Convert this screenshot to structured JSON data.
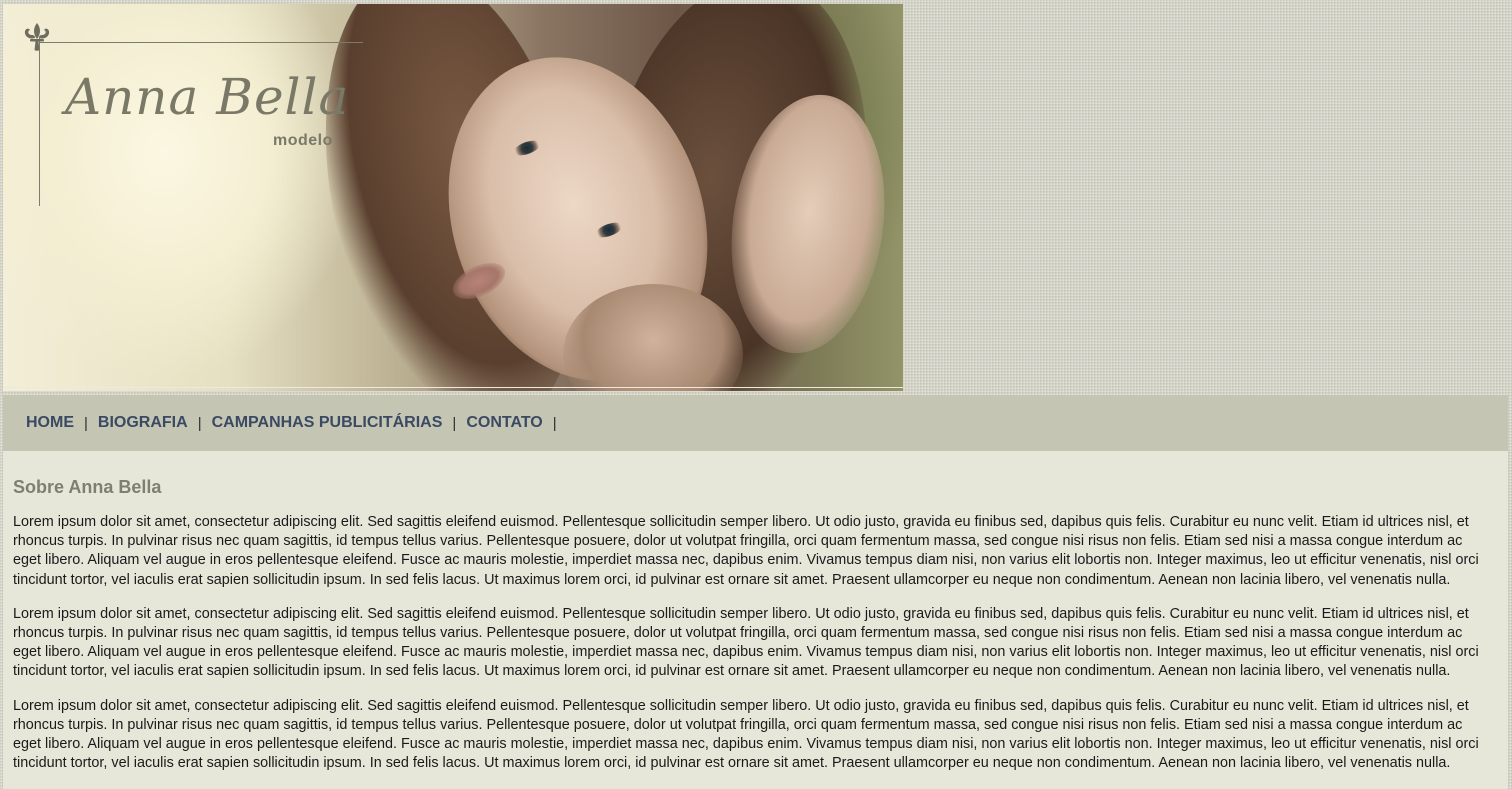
{
  "header": {
    "logo_name": "Anna Bella",
    "logo_subtitle": "modelo",
    "logo_icon": "fleur-de-lis-icon",
    "photo_subject": "banner-photo"
  },
  "nav": {
    "items": [
      {
        "label": "HOME"
      },
      {
        "label": "BIOGRAFIA"
      },
      {
        "label": "CAMPANHAS PUBLICITÁRIAS"
      },
      {
        "label": "CONTATO"
      }
    ],
    "separator": "|"
  },
  "main": {
    "title": "Sobre Anna Bella",
    "paragraphs": [
      "Lorem ipsum dolor sit amet, consectetur adipiscing elit. Sed sagittis eleifend euismod. Pellentesque sollicitudin semper libero. Ut odio justo, gravida eu finibus sed, dapibus quis felis. Curabitur eu nunc velit. Etiam id ultrices nisl, et rhoncus turpis. In pulvinar risus nec quam sagittis, id tempus tellus varius. Pellentesque posuere, dolor ut volutpat fringilla, orci quam fermentum massa, sed congue nisi risus non felis. Etiam sed nisi a massa congue interdum ac eget libero. Aliquam vel augue in eros pellentesque eleifend. Fusce ac mauris molestie, imperdiet massa nec, dapibus enim. Vivamus tempus diam nisi, non varius elit lobortis non. Integer maximus, leo ut efficitur venenatis, nisl orci tincidunt tortor, vel iaculis erat sapien sollicitudin ipsum. In sed felis lacus. Ut maximus lorem orci, id pulvinar est ornare sit amet. Praesent ullamcorper eu neque non condimentum. Aenean non lacinia libero, vel venenatis nulla.",
      "Lorem ipsum dolor sit amet, consectetur adipiscing elit. Sed sagittis eleifend euismod. Pellentesque sollicitudin semper libero. Ut odio justo, gravida eu finibus sed, dapibus quis felis. Curabitur eu nunc velit. Etiam id ultrices nisl, et rhoncus turpis. In pulvinar risus nec quam sagittis, id tempus tellus varius. Pellentesque posuere, dolor ut volutpat fringilla, orci quam fermentum massa, sed congue nisi risus non felis. Etiam sed nisi a massa congue interdum ac eget libero. Aliquam vel augue in eros pellentesque eleifend. Fusce ac mauris molestie, imperdiet massa nec, dapibus enim. Vivamus tempus diam nisi, non varius elit lobortis non. Integer maximus, leo ut efficitur venenatis, nisl orci tincidunt tortor, vel iaculis erat sapien sollicitudin ipsum. In sed felis lacus. Ut maximus lorem orci, id pulvinar est ornare sit amet. Praesent ullamcorper eu neque non condimentum. Aenean non lacinia libero, vel venenatis nulla.",
      "Lorem ipsum dolor sit amet, consectetur adipiscing elit. Sed sagittis eleifend euismod. Pellentesque sollicitudin semper libero. Ut odio justo, gravida eu finibus sed, dapibus quis felis. Curabitur eu nunc velit. Etiam id ultrices nisl, et rhoncus turpis. In pulvinar risus nec quam sagittis, id tempus tellus varius. Pellentesque posuere, dolor ut volutpat fringilla, orci quam fermentum massa, sed congue nisi risus non felis. Etiam sed nisi a massa congue interdum ac eget libero. Aliquam vel augue in eros pellentesque eleifend. Fusce ac mauris molestie, imperdiet massa nec, dapibus enim. Vivamus tempus diam nisi, non varius elit lobortis non. Integer maximus, leo ut efficitur venenatis, nisl orci tincidunt tortor, vel iaculis erat sapien sollicitudin ipsum. In sed felis lacus. Ut maximus lorem orci, id pulvinar est ornare sit amet. Praesent ullamcorper eu neque non condimentum. Aenean non lacinia libero, vel venenatis nulla."
    ]
  },
  "colors": {
    "page_background": "#d3d3c6",
    "nav_background": "#c5c5b3",
    "nav_link": "#3a4a63",
    "content_background": "#e6e6d9",
    "title_text": "#7e7e72",
    "logo_text": "#7a7867"
  }
}
